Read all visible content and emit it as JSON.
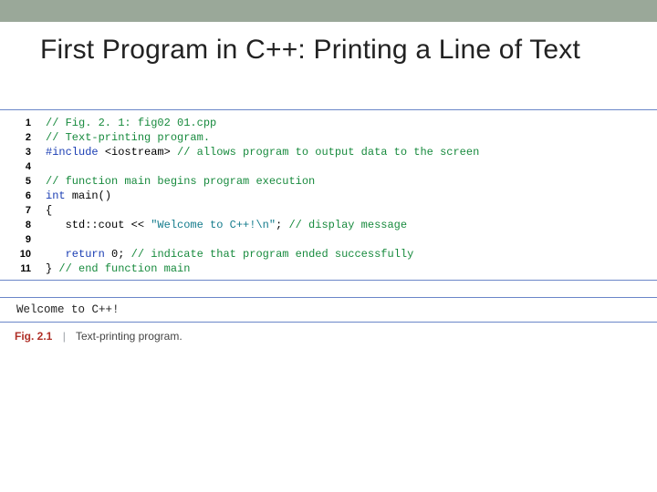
{
  "title": "First Program in C++: Printing a Line of Text",
  "code": {
    "lines": [
      {
        "n": "1",
        "t": [
          "cmt"
        ],
        "s": [
          "// Fig. 2. 1: fig02 01.cpp"
        ]
      },
      {
        "n": "2",
        "t": [
          "cmt"
        ],
        "s": [
          "// Text-printing program."
        ]
      },
      {
        "n": "3",
        "t": [
          "kw",
          "",
          "cmt"
        ],
        "s": [
          "#include ",
          "<iostream> ",
          "// allows program to output data to the screen"
        ]
      },
      {
        "n": "4",
        "t": [
          ""
        ],
        "s": [
          ""
        ]
      },
      {
        "n": "5",
        "t": [
          "cmt"
        ],
        "s": [
          "// function main begins program execution"
        ]
      },
      {
        "n": "6",
        "t": [
          "kw",
          ""
        ],
        "s": [
          "int ",
          "main()"
        ]
      },
      {
        "n": "7",
        "t": [
          ""
        ],
        "s": [
          "{"
        ]
      },
      {
        "n": "8",
        "t": [
          "",
          "str",
          "",
          "cmt"
        ],
        "s": [
          "   std::cout << ",
          "\"Welcome to C++!\\n\"",
          "; ",
          "// display message"
        ]
      },
      {
        "n": "9",
        "t": [
          ""
        ],
        "s": [
          ""
        ]
      },
      {
        "n": "10",
        "t": [
          "",
          "kw",
          "",
          "cmt"
        ],
        "s": [
          "   ",
          "return ",
          "0; ",
          "// indicate that program ended successfully"
        ]
      },
      {
        "n": "11",
        "t": [
          "",
          "cmt"
        ],
        "s": [
          "} ",
          "// end function main"
        ]
      }
    ]
  },
  "output": "Welcome to C++!",
  "caption": {
    "label": "Fig. 2.1",
    "separator": "|",
    "text": "Text-printing program."
  }
}
